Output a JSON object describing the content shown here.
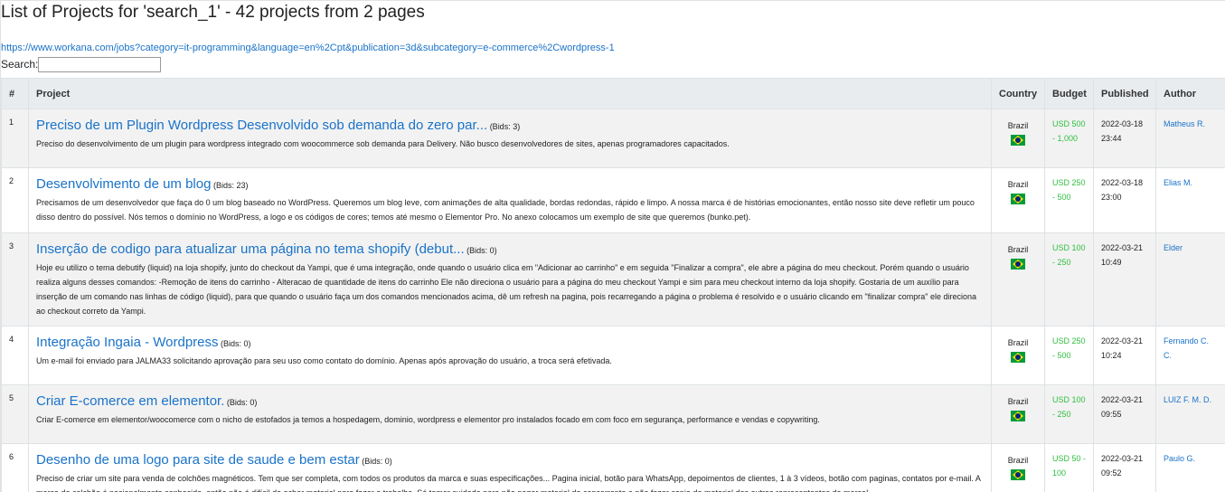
{
  "page": {
    "title": "List of Projects for 'search_1' - 42 projects from 2 pages",
    "url": "https://www.workana.com/jobs?category=it-programming&language=en%2Cpt&publication=3d&subcategory=e-commerce%2Cwordpress-1",
    "search_label": "Search:",
    "search_value": ""
  },
  "table": {
    "headers": {
      "num": "#",
      "project": "Project",
      "country": "Country",
      "budget": "Budget",
      "published": "Published",
      "author": "Author"
    },
    "rows": [
      {
        "num": "1",
        "title": "Preciso de um Plugin Wordpress Desenvolvido sob demanda do zero par...",
        "bids": "(Bids: 3)",
        "description": "Preciso do desenvolvimento de um plugin para wordpress integrado com woocommerce sob demanda para Delivery. Não busco desenvolvedores de sites, apenas programadores capacitados.",
        "country": "Brazil",
        "budget": "USD 500 - 1,000",
        "published": "2022-03-18 23:44",
        "author": "Matheus R."
      },
      {
        "num": "2",
        "title": "Desenvolvimento de um blog",
        "bids": "(Bids: 23)",
        "description": "Precisamos de um desenvolvedor que faça do 0 um blog baseado no WordPress. Queremos um blog leve, com animações de alta qualidade, bordas redondas, rápido e limpo. A nossa marca é de histórias emocionantes, então nosso site deve refletir um pouco disso dentro do possível. Nós temos o domínio no WordPress, a logo e os códigos de cores; temos até mesmo o Elementor Pro. No anexo colocamos um exemplo de site que queremos (bunko.pet).",
        "country": "Brazil",
        "budget": "USD 250 - 500",
        "published": "2022-03-18 23:00",
        "author": "Elias M."
      },
      {
        "num": "3",
        "title": "Inserção de codigo para atualizar uma página no tema shopify (debut...",
        "bids": "(Bids: 0)",
        "description": "Hoje eu utilizo o tema debutify (liquid) na loja shopify, junto do checkout da Yampi, que é uma integração, onde quando o usuário clica em \"Adicionar ao carrinho\" e em seguida \"Finalizar a compra\", ele abre a página do meu checkout. Porém quando o usuário realiza alguns desses comandos: -Remoção de itens do carrinho - Alteracao de quantidade de itens do carrinho Ele não direciona o usuário para a página do meu checkout Yampi e sim para meu checkout interno da loja shopify. Gostaria de um auxílio para inserção de um comando nas linhas de código (liquid), para que quando o usuário faça um dos comandos mencionados acima, dê um refresh na pagina, pois recarregando a página o problema é resolvido e o usuário clicando em \"finalizar compra\" ele direciona ao checkout correto da Yampi.",
        "country": "Brazil",
        "budget": "USD 100 - 250",
        "published": "2022-03-21 10:49",
        "author": "Elder"
      },
      {
        "num": "4",
        "title": "Integração Ingaia - Wordpress",
        "bids": "(Bids: 0)",
        "description": "Um e-mail foi enviado para JALMA33 solicitando aprovação para seu uso como contato do domínio. Apenas após aprovação do usuário, a troca será efetivada.",
        "country": "Brazil",
        "budget": "USD 250 - 500",
        "published": "2022-03-21 10:24",
        "author": "Fernando C. C."
      },
      {
        "num": "5",
        "title": "Criar E-comerce em elementor.",
        "bids": "(Bids: 0)",
        "description": "Criar E-comerce em elementor/woocomerce com o nicho de estofados ja temos a hospedagem, dominio, wordpress e elementor pro instalados focado em com foco em segurança, performance e vendas e copywriting.",
        "country": "Brazil",
        "budget": "USD 100 - 250",
        "published": "2022-03-21 09:55",
        "author": "LUIZ F. M. D."
      },
      {
        "num": "6",
        "title": "Desenho de uma logo para site de saude e bem estar",
        "bids": "(Bids: 0)",
        "description": "Preciso de criar um site para venda de colchões magnéticos. Tem que ser completa, com todos os produtos da marca e suas especificações... Pagina inicial, botão para WhatsApp, depoimentos de clientes, 1 à 3 vídeos, botão com paginas, contatos por e-mail. A marca do colchão é nacionalmente conhecida, então não é difícil de achar material para fazer o trabalho. Só tomar cuidado para não pegar material de concorrente e não fazer copia de material dos outros representantes da marca!",
        "country": "Brazil",
        "budget": "USD 50 - 100",
        "published": "2022-03-21 09:52",
        "author": "Paulo G."
      }
    ]
  }
}
